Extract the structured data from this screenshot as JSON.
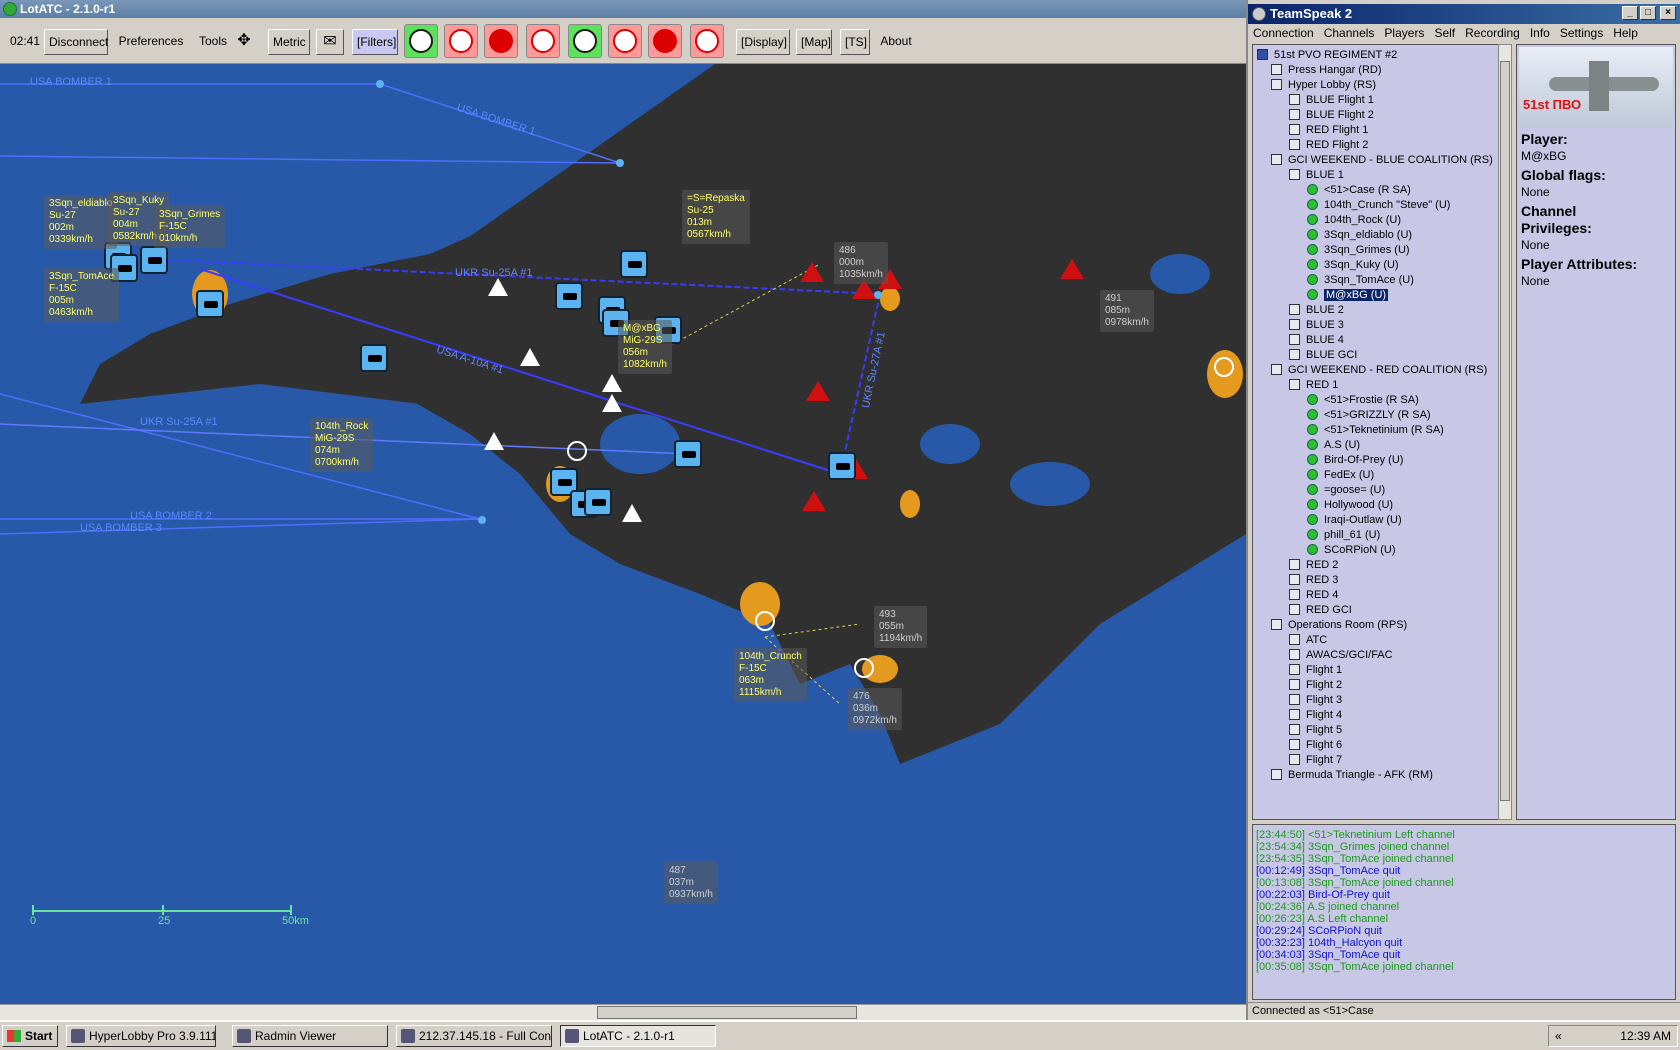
{
  "lotatc": {
    "title": "LotATC - 2.1.0-r1",
    "toolbar": {
      "time": "02:41",
      "disconnect": "Disconnect",
      "preferences": "Preferences",
      "tools": "Tools",
      "metric": "Metric",
      "filters": "[Filters]",
      "display": "[Display]",
      "map": "[Map]",
      "ts": "[TS]",
      "about": "About"
    },
    "routes": [
      "USA BOMBER 1",
      "USA BOMBER 1",
      "USA BOMBER 2",
      "USA BOMBER 3",
      "UKR Su-25A #1",
      "USA A-10A #1",
      "UKR Su-25A #1",
      "UKR Su-27A #1"
    ],
    "aircraft": [
      {
        "lines": [
          "3Sqn_eldiablo",
          "Su-27",
          "002m",
          "0339km/h"
        ]
      },
      {
        "lines": [
          "3Sqn_Kuky",
          "Su-27",
          "004m",
          "0582km/h"
        ]
      },
      {
        "lines": [
          "3Sqn_Grimes",
          "F-15C",
          "010km/h"
        ]
      },
      {
        "lines": [
          "3Sqn_TomAce",
          "F-15C",
          "005m",
          "0463km/h"
        ]
      },
      {
        "lines": [
          "=S=Repaska",
          "Su-25",
          "013m",
          "0567km/h"
        ]
      },
      {
        "lines": [
          "M@xBG",
          "MiG-29S",
          "056m",
          "1082km/h"
        ]
      },
      {
        "lines": [
          "104th_Rock",
          "MiG-29S",
          "074m",
          "0700km/h"
        ]
      },
      {
        "lines": [
          "104th_Crunch",
          "F-15C",
          "063m",
          "1115km/h"
        ]
      }
    ],
    "contacts": [
      {
        "lines": [
          "486",
          "000m",
          "1035km/h"
        ]
      },
      {
        "lines": [
          "491",
          "085m",
          "0978km/h"
        ]
      },
      {
        "lines": [
          "493",
          "055m",
          "1194km/h"
        ]
      },
      {
        "lines": [
          "476",
          "036m",
          "0972km/h"
        ]
      },
      {
        "lines": [
          "487",
          "037m",
          "0937km/h"
        ]
      }
    ],
    "scale": {
      "labels": [
        "0",
        "25",
        "50km"
      ]
    }
  },
  "teamspeak": {
    "title": "TeamSpeak 2",
    "menu": [
      "Connection",
      "Channels",
      "Players",
      "Self",
      "Recording",
      "Info",
      "Settings",
      "Help"
    ],
    "tree": [
      "51st PVO REGIMENT #2",
      "Press Hangar   (RD)",
      "Hyper Lobby   (RS)",
      "BLUE Flight 1",
      "BLUE Flight 2",
      "RED Flight 1",
      "RED Flight 2",
      "GCI WEEKEND - BLUE COALITION   (RS)",
      "BLUE 1",
      "<51>Case  (R SA)",
      "104th_Crunch \"Steve\"  (U)",
      "104th_Rock  (U)",
      "3Sqn_eldiablo  (U)",
      "3Sqn_Grimes  (U)",
      "3Sqn_Kuky  (U)",
      "3Sqn_TomAce  (U)",
      "M@xBG  (U)",
      "BLUE 2",
      "BLUE 3",
      "BLUE 4",
      "BLUE GCI",
      "GCI WEEKEND - RED COALITION   (RS)",
      "RED 1",
      "<51>Frostie  (R SA)",
      "<51>GRIZZLY  (R SA)",
      "<51>Teknetinium  (R SA)",
      "A.S  (U)",
      "Bird-Of-Prey  (U)",
      "FedEx  (U)",
      "=goose=  (U)",
      "Hollywood  (U)",
      "Iraqi-Outlaw  (U)",
      "phill_61  (U)",
      "SCoRPioN  (U)",
      "RED 2",
      "RED 3",
      "RED 4",
      "RED GCI",
      "Operations Room   (RPS)",
      "ATC",
      "AWACS/GCI/FAC",
      "Flight 1",
      "Flight 2",
      "Flight 3",
      "Flight 4",
      "Flight 5",
      "Flight 6",
      "Flight 7",
      "Bermuda Triangle - AFK   (RM)"
    ],
    "info": {
      "logo_text": "51st ПВО",
      "player_label": "Player:",
      "player_value": "M@xBG",
      "flags_label": "Global flags:",
      "flags_value": "None",
      "channel_label": "Channel",
      "privileges_label": "Privileges:",
      "privileges_value": "None",
      "attributes_label": "Player Attributes:",
      "attributes_value": "None"
    },
    "log": [
      {
        "text": "[23:44:50] <51>Teknetinium Left channel",
        "color": "#1a9a1a"
      },
      {
        "text": "[23:54:34] 3Sqn_Grimes joined channel",
        "color": "#1a9a1a"
      },
      {
        "text": "[23:54:35] 3Sqn_TomAce joined channel",
        "color": "#1a9a1a"
      },
      {
        "text": "[00:12:49] 3Sqn_TomAce quit",
        "color": "#1010d0"
      },
      {
        "text": "[00:13:08] 3Sqn_TomAce joined channel",
        "color": "#1a9a1a"
      },
      {
        "text": "[00:22:03] Bird-Of-Prey quit",
        "color": "#1010d0"
      },
      {
        "text": "[00:24:36] A.S joined channel",
        "color": "#1a9a1a"
      },
      {
        "text": "[00:26:23] A.S Left channel",
        "color": "#1a9a1a"
      },
      {
        "text": "[00:29:24] SCoRPioN quit",
        "color": "#1010d0"
      },
      {
        "text": "[00:32:23] 104th_Halcyon quit",
        "color": "#1010d0"
      },
      {
        "text": "[00:34:03] 3Sqn_TomAce quit",
        "color": "#1010d0"
      },
      {
        "text": "[00:35:08] 3Sqn_TomAce joined channel",
        "color": "#1a9a1a"
      }
    ],
    "status": "Connected as <51>Case"
  },
  "taskbar": {
    "start": "Start",
    "tasks": [
      "HyperLobby Pro 3.9.111",
      "Radmin Viewer",
      "212.37.145.18 - Full Con...",
      "LotATC - 2.1.0-r1"
    ],
    "clock": "12:39 AM"
  }
}
